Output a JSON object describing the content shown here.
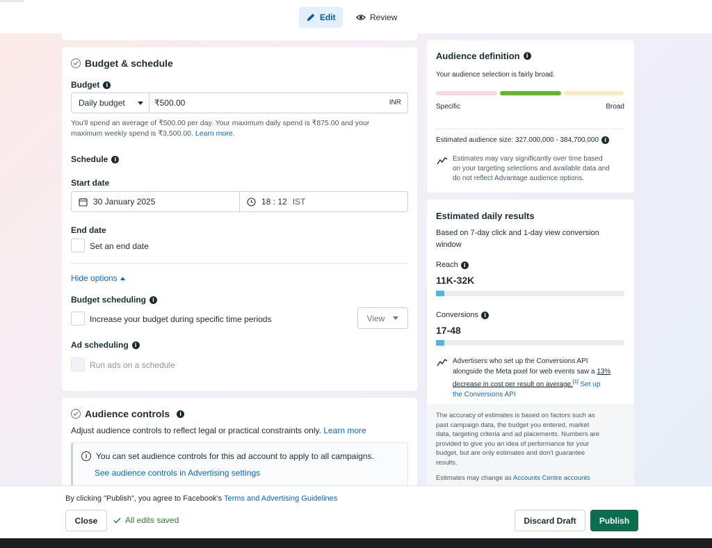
{
  "tabs": {
    "edit": "Edit",
    "review": "Review"
  },
  "budget_schedule": {
    "title": "Budget & schedule",
    "budget_label": "Budget",
    "budget_type": "Daily budget",
    "amount": "₹500.00",
    "currency": "INR",
    "desc_1": "You'll spend an average of ₹500.00 per day. Your maximum daily spend is ₹875.00 and your",
    "desc_2": "maximum weekly spend is ₹3,500.00.",
    "learn_more": "Learn more.",
    "schedule_label": "Schedule",
    "start_date_label": "Start date",
    "start_date": "30 January 2025",
    "start_time": "18 : 12",
    "timezone": "IST",
    "end_date_label": "End date",
    "end_date_checkbox": "Set an end date",
    "hide_options": "Hide options",
    "budget_scheduling_label": "Budget scheduling",
    "budget_scheduling_checkbox": "Increase your budget during specific time periods",
    "view_button": "View",
    "ad_scheduling_label": "Ad scheduling",
    "ad_scheduling_checkbox": "Run ads on a schedule"
  },
  "audience_controls": {
    "title": "Audience controls",
    "desc": "Adjust audience controls to reflect legal or practical constraints only.",
    "learn_more": "Learn more",
    "notice": "You can set audience controls for this ad account to apply to all campaigns.",
    "settings_link": "See audience controls in Advertising settings"
  },
  "audience_definition": {
    "title": "Audience definition",
    "summary": "Your audience selection is fairly broad.",
    "specific": "Specific",
    "broad": "Broad",
    "estimated_size": "Estimated audience size: 327,000,000 - 384,700,000",
    "note_1": "Estimates may vary significantly over time based",
    "note_2": "on your targeting selections and available data and",
    "note_3": "do not reflect Advantage audience options.",
    "colors": {
      "low": "#f7d9dc",
      "mid": "#63b725",
      "high": "#f5ebc0"
    }
  },
  "daily_results": {
    "title": "Estimated daily results",
    "basis_1": "Based on 7-day click and 1-day view conversion",
    "basis_2": "window",
    "reach_label": "Reach",
    "reach_value": "11K-32K",
    "reach_fraction": 0.045,
    "conversions_label": "Conversions",
    "conversions_value": "17-48",
    "conversions_fraction": 0.045,
    "tip_1": "Advertisers who set up the Conversions API",
    "tip_2": "alongside the Meta pixel for web events saw a",
    "tip_pct": "13%",
    "tip_3": "decrease in cost per result on average.",
    "tip_ref": "[1]",
    "tip_link_1": "Set up",
    "tip_link_2": "the Conversions API",
    "accuracy_1": "The accuracy of estimates is based on factors such as",
    "accuracy_2": "past campaign data, the budget you entered, market",
    "accuracy_3": "data, targeting criteria and ad placements. Numbers are",
    "accuracy_4": "provided to give you an idea of performance for your",
    "accuracy_5": "budget, but are only estimates and don't guarantee",
    "accuracy_6": "results.",
    "change_note": "Estimates may change as",
    "change_link": "Accounts Centre accounts"
  },
  "footer": {
    "agree_text": "By clicking \"Publish\", you agree to Facebook's",
    "terms_link": "Terms and Advertising Guidelines",
    "close": "Close",
    "saved": "All edits saved",
    "discard": "Discard Draft",
    "publish": "Publish",
    "publish_color": "#0b6e4f"
  }
}
